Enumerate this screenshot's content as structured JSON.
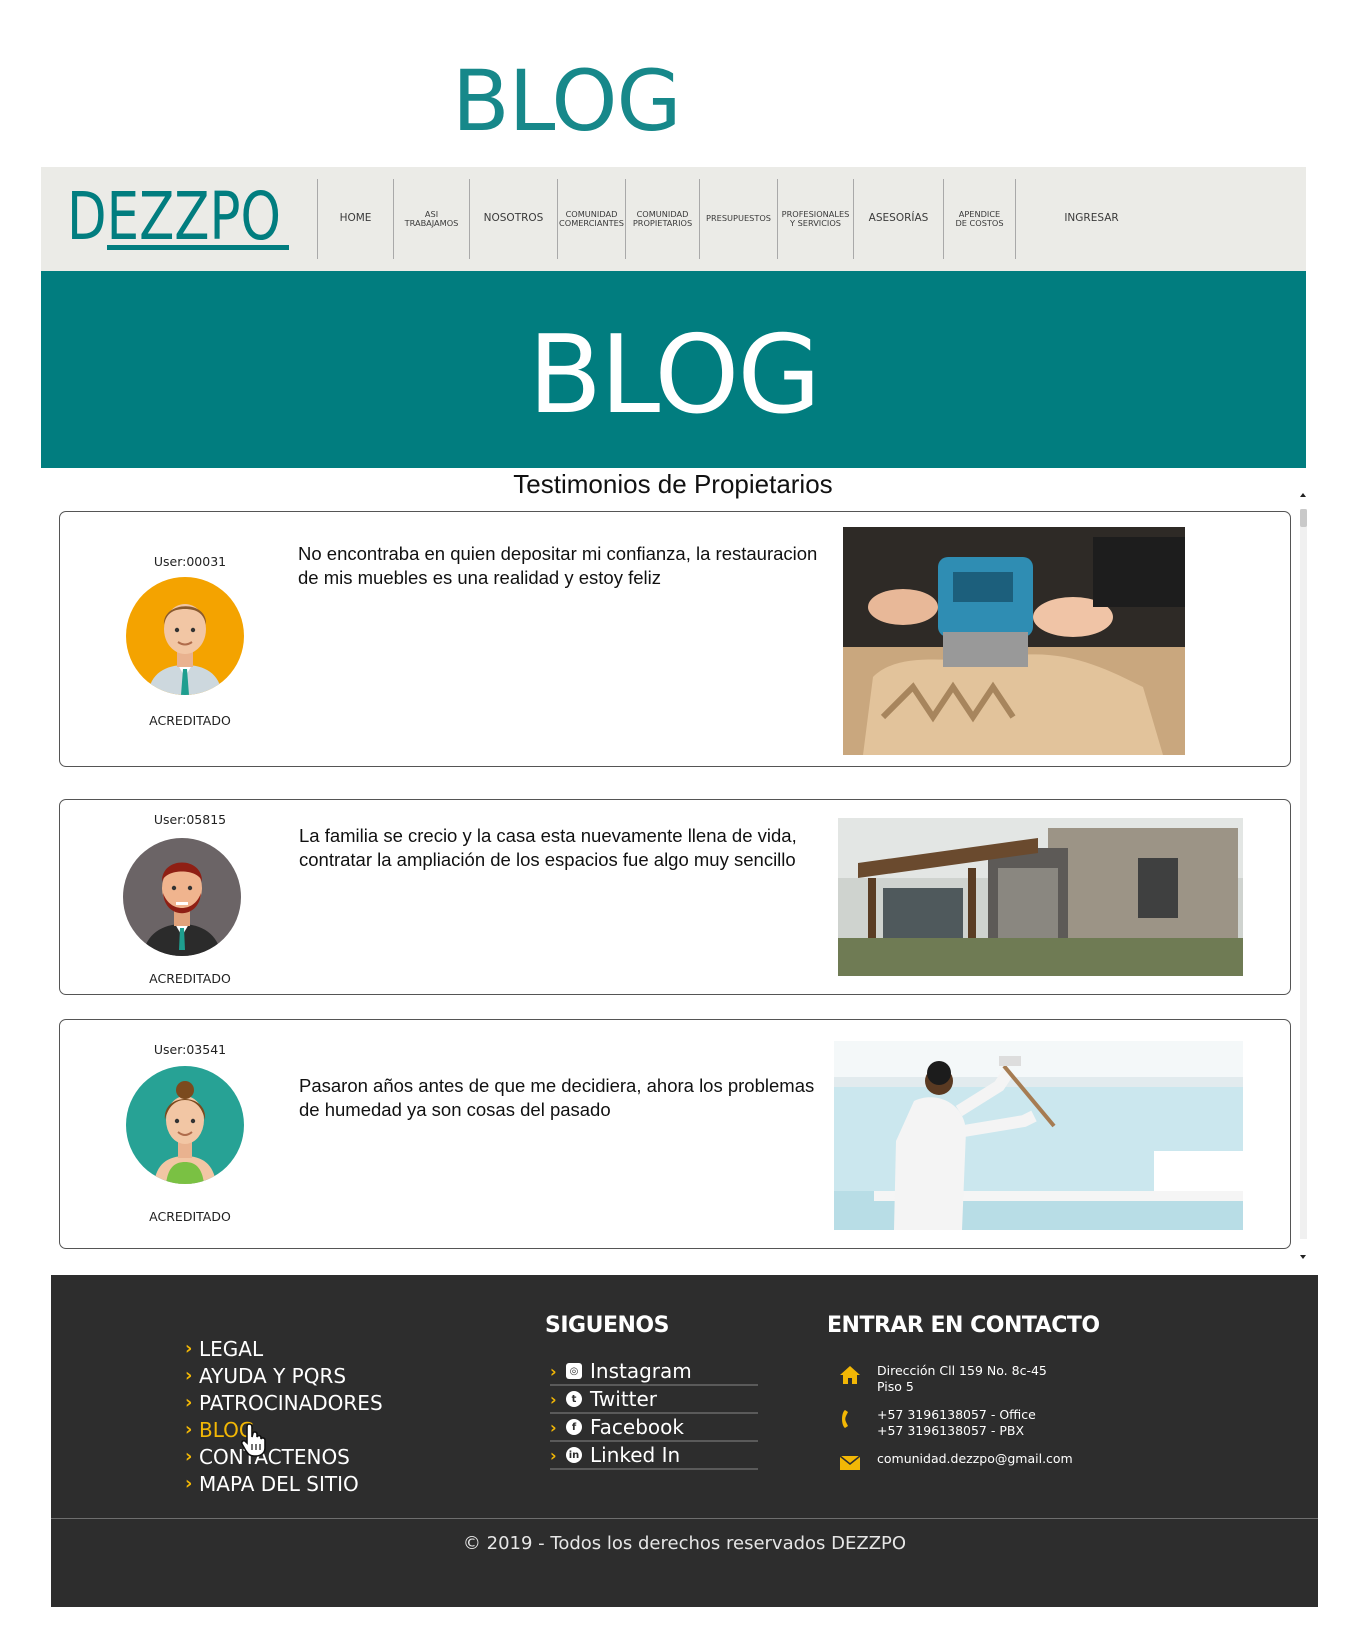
{
  "page_title": "BLOG",
  "brand": {
    "logo_text": "DEZZPO"
  },
  "nav": {
    "items": [
      {
        "label": "HOME"
      },
      {
        "label": "ASI TRABAJAMOS"
      },
      {
        "label": "NOSOTROS"
      },
      {
        "label": "COMUNIDAD COMERCIANTES"
      },
      {
        "label": "COMUNIDAD PROPIETARIOS"
      },
      {
        "label": "PRESUPUESTOS"
      },
      {
        "label": "PROFESIONALES Y SERVICIOS"
      },
      {
        "label": "ASESORÍAS"
      },
      {
        "label": "APENDICE DE COSTOS"
      },
      {
        "label": "INGRESAR"
      }
    ]
  },
  "hero": {
    "title": "BLOG"
  },
  "section_title": "Testimonios de Propietarios",
  "testimonials": [
    {
      "user": "User:00031",
      "status": "ACREDITADO",
      "text_line1": "No encontraba en quien depositar mi confianza, la restauracion",
      "text_line2": "de mis muebles es una realidad y estoy feliz",
      "photo": "woodworking-router-carving"
    },
    {
      "user": "User:05815",
      "status": "ACREDITADO",
      "text_line1": "La familia se crecio y la casa esta nuevamente llena de vida,",
      "text_line2": "contratar la ampliación de los espacios fue  algo muy sencillo",
      "photo": "modern-house-extension"
    },
    {
      "user": "User:03541",
      "status": "ACREDITADO",
      "text_line1": "Pasaron años antes de que me decidiera, ahora los problemas",
      "text_line2": "de humedad ya son cosas del pasado",
      "photo": "painter-rolling-wall"
    }
  ],
  "footer": {
    "links": [
      {
        "label": "LEGAL"
      },
      {
        "label": "AYUDA Y PQRS"
      },
      {
        "label": "PATROCINADORES"
      },
      {
        "label": "BLOG"
      },
      {
        "label": "CONTACTENOS"
      },
      {
        "label": "MAPA DEL SITIO"
      }
    ],
    "social_heading": "SIGUENOS",
    "social": [
      {
        "label": "Instagram",
        "icon": "instagram-icon"
      },
      {
        "label": "Twitter",
        "icon": "twitter-icon"
      },
      {
        "label": "Facebook",
        "icon": "facebook-icon"
      },
      {
        "label": "Linked In",
        "icon": "linkedin-icon"
      }
    ],
    "contact_heading": "ENTRAR EN CONTACTO",
    "address_line1": "Dirección  Cll 159 No. 8c-45",
    "address_line2": "Piso 5",
    "phone_line1": "+57 3196138057 - Office",
    "phone_line2": "+57 3196138057 - PBX",
    "email": "comunidad.dezzpo@gmail.com",
    "copyright": "© 2019 - Todos los derechos reservados DEZZPO"
  },
  "colors": {
    "teal": "#017d7f",
    "accent_yellow": "#f2b705",
    "footer_bg": "#2d2d2d",
    "nav_bg": "#ebebe7"
  }
}
